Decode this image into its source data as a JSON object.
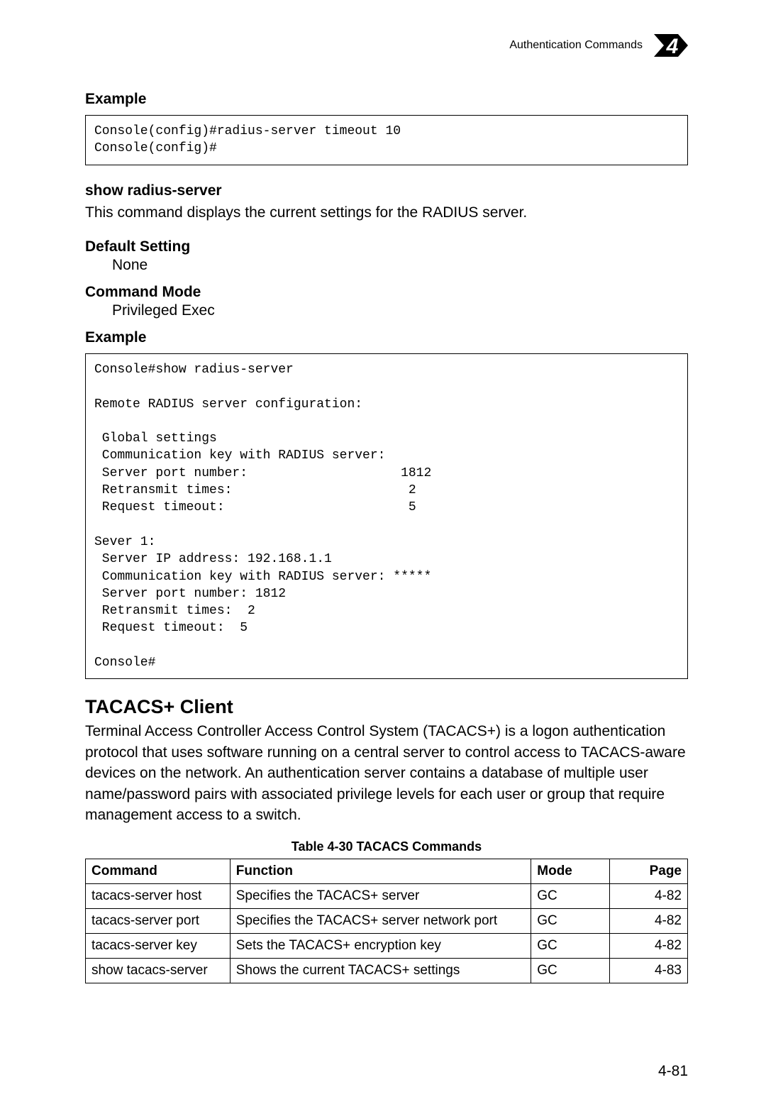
{
  "header": {
    "title": "Authentication Commands",
    "chapter_number": "4"
  },
  "sections": {
    "example1_heading": "Example",
    "example1_code": "Console(config)#radius-server timeout 10\nConsole(config)#",
    "show_radius_heading": "show radius-server",
    "show_radius_desc": "This command displays the current settings for the RADIUS server.",
    "default_setting_heading": "Default Setting",
    "default_setting_value": "None",
    "command_mode_heading": "Command Mode",
    "command_mode_value": "Privileged Exec",
    "example2_heading": "Example",
    "example2_code": "Console#show radius-server\n\nRemote RADIUS server configuration:\n\n Global settings\n Communication key with RADIUS server:\n Server port number:                    1812\n Retransmit times:                       2\n Request timeout:                        5\n\nSever 1:\n Server IP address: 192.168.1.1\n Communication key with RADIUS server: *****\n Server port number: 1812\n Retransmit times:  2\n Request timeout:  5\n\nConsole#",
    "tacacs_heading": "TACACS+ Client",
    "tacacs_para": "Terminal Access Controller Access Control System (TACACS+) is a logon authentication protocol that uses software running on a central server to control access to TACACS-aware devices on the network. An authentication server contains a database of multiple user name/password pairs with associated privilege levels for each user or group that require management access to a switch."
  },
  "table": {
    "caption": "Table 4-30  TACACS Commands",
    "headers": [
      "Command",
      "Function",
      "Mode",
      "Page"
    ],
    "rows": [
      {
        "command": "tacacs-server host",
        "function": "Specifies the TACACS+ server",
        "mode": "GC",
        "page": "4-82"
      },
      {
        "command": "tacacs-server port",
        "function": "Specifies the TACACS+ server network port",
        "mode": "GC",
        "page": "4-82"
      },
      {
        "command": "tacacs-server key",
        "function": "Sets the TACACS+ encryption key",
        "mode": "GC",
        "page": "4-82"
      },
      {
        "command": "show tacacs-server",
        "function": "Shows the current TACACS+ settings",
        "mode": "GC",
        "page": "4-83"
      }
    ]
  },
  "page_number": "4-81"
}
